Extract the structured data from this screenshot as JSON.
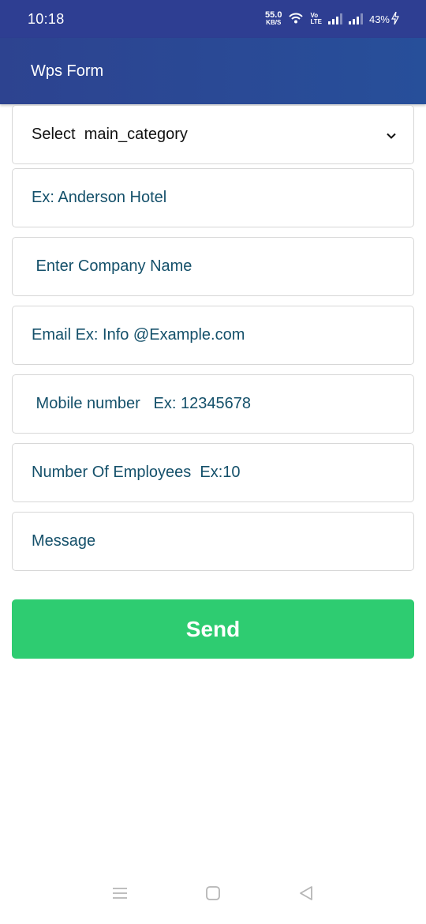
{
  "status_bar": {
    "time": "10:18",
    "net_speed_value": "55.0",
    "net_speed_unit": "KB/S",
    "volte_top": "Vo",
    "volte_bottom": "LTE",
    "battery": "43%"
  },
  "app_bar": {
    "title": "Wps Form"
  },
  "form": {
    "category_select": {
      "label": "Select  main_category",
      "icon": "chevron-down-icon"
    },
    "hotel_field": {
      "placeholder": "Ex: Anderson Hotel"
    },
    "company_field": {
      "placeholder": " Enter Company Name"
    },
    "email_field": {
      "placeholder": "Email Ex: Info @Example.com"
    },
    "mobile_field": {
      "placeholder": " Mobile number   Ex: 12345678"
    },
    "employees_field": {
      "placeholder": "Number Of Employees  Ex:10"
    },
    "message_field": {
      "placeholder": "Message"
    },
    "send_label": "Send"
  },
  "colors": {
    "status_bar": "#2e3e92",
    "app_bar": "#274f9a",
    "send_button": "#2ecc71",
    "placeholder_text": "#14506a"
  },
  "nav_bar": {
    "icons": [
      "menu-icon",
      "home-square-icon",
      "back-triangle-icon"
    ]
  }
}
